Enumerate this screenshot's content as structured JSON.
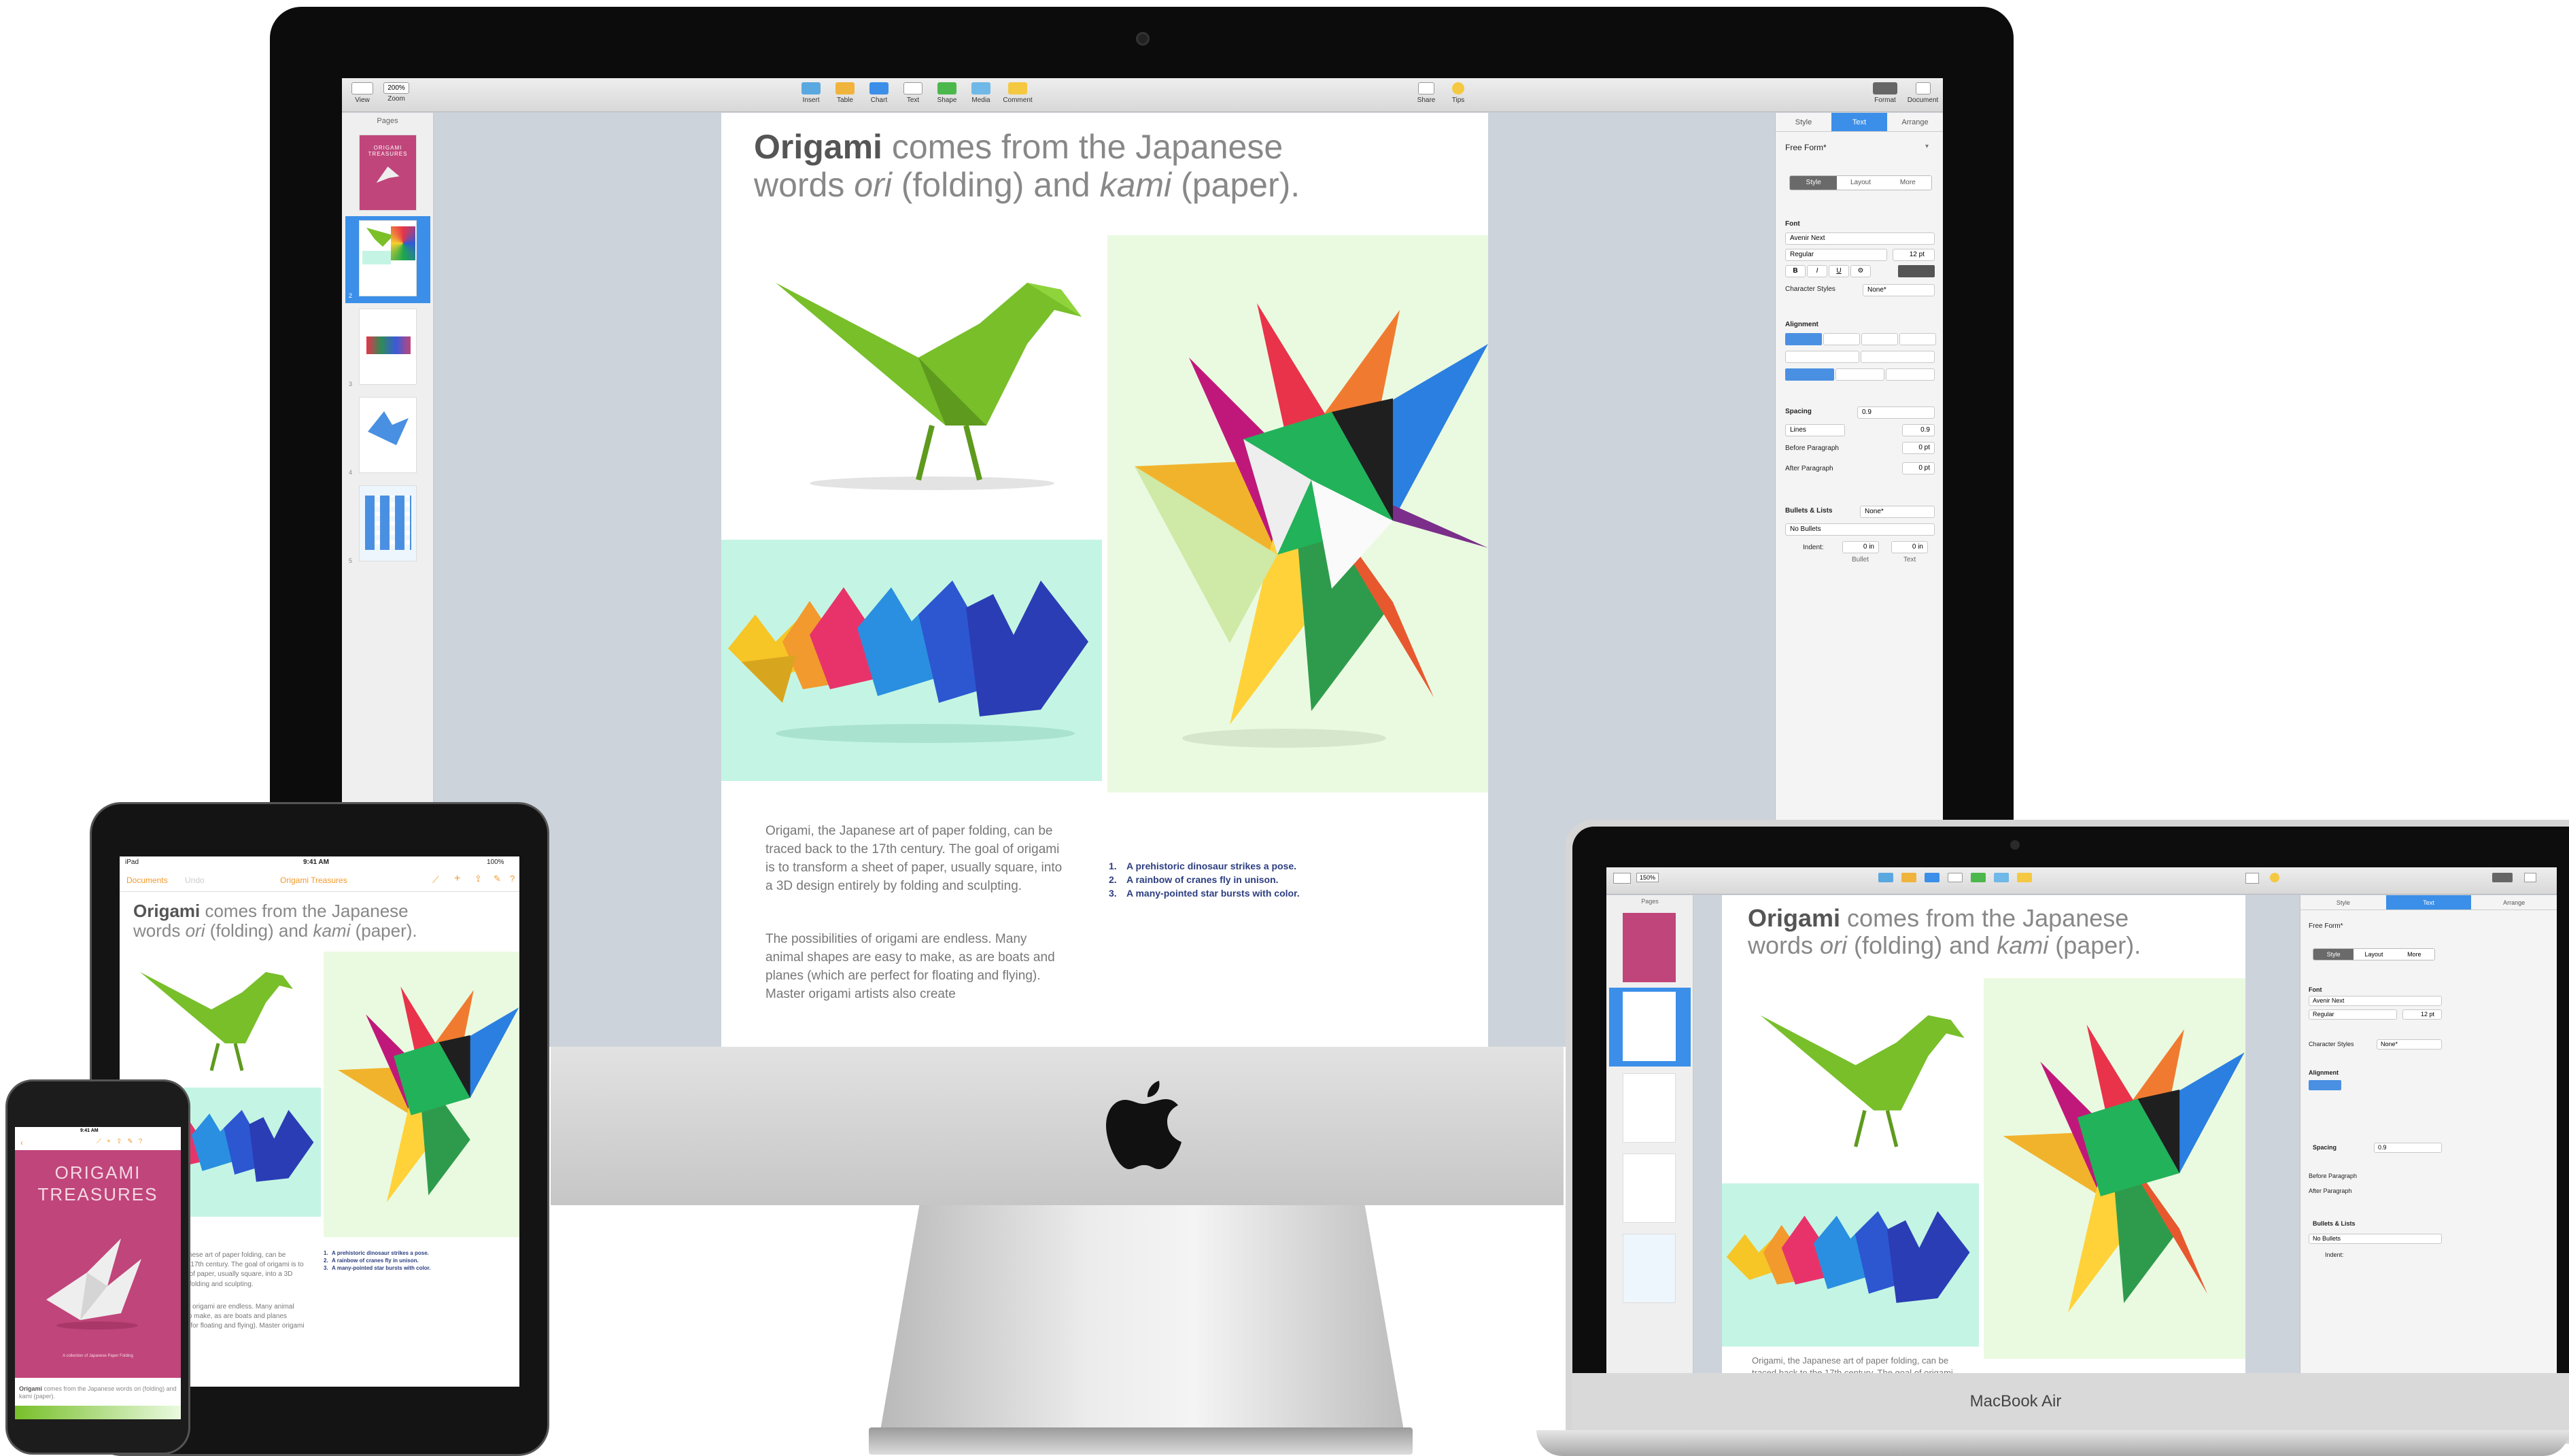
{
  "imac": {
    "toolbar": {
      "view": "View",
      "zoom_value": "200%",
      "zoom": "Zoom",
      "insert": "Insert",
      "table": "Table",
      "chart": "Chart",
      "text": "Text",
      "shape": "Shape",
      "media": "Media",
      "comment": "Comment",
      "share": "Share",
      "tips": "Tips",
      "format": "Format",
      "document": "Document"
    },
    "pages_label": "Pages",
    "page_numbers": [
      "1",
      "2",
      "3",
      "4",
      "5"
    ],
    "inspector": {
      "tabs": [
        "Style",
        "Text",
        "Arrange"
      ],
      "selected_tab": "Text",
      "paragraph_style": "Free Form*",
      "subtabs": [
        "Style",
        "Layout",
        "More"
      ],
      "font_label": "Font",
      "font_name": "Avenir Next",
      "font_weight": "Regular",
      "font_size": "12 pt",
      "format_buttons": [
        "B",
        "I",
        "U"
      ],
      "char_styles_label": "Character Styles",
      "char_styles_value": "None*",
      "alignment_label": "Alignment",
      "spacing_label": "Spacing",
      "spacing_value": "0.9",
      "lines_label": "Lines",
      "lines_value": "0.9",
      "before_paragraph_label": "Before Paragraph",
      "before_paragraph_value": "0 pt",
      "after_paragraph_label": "After Paragraph",
      "after_paragraph_value": "0 pt",
      "bullets_label": "Bullets & Lists",
      "bullets_value": "None*",
      "no_bullets": "No Bullets",
      "indent_label": "Indent:",
      "indent_bullet_value": "0 in",
      "indent_text_value": "0 in",
      "bullet_label": "Bullet",
      "text_label": "Text"
    }
  },
  "document": {
    "heading_bold": "Origami",
    "heading_rest_1": " comes from the Japanese",
    "heading_line2_a": "words ",
    "heading_ori": "ori",
    "heading_line2_b": " (folding) and ",
    "heading_kami": "kami",
    "heading_line2_c": " (paper).",
    "paragraph_1": "Origami, the Japanese art of paper folding, can be traced back to the 17th century. The goal of origami is to transform a sheet of paper, usually square, into a 3D design entirely by folding and sculpting.",
    "paragraph_2": "The possibilities of origami are endless. Many animal shapes are easy to make, as are boats and planes (which are perfect for floating and flying). Master origami artists also create",
    "captions": [
      "A prehistoric dinosaur strikes a pose.",
      "A rainbow of cranes fly in unison.",
      "A many-pointed star bursts with color."
    ],
    "caption_nums": [
      "1.",
      "2.",
      "3."
    ]
  },
  "ipad": {
    "status_left": "iPad",
    "status_time": "9:41 AM",
    "status_battery": "100%",
    "nav_documents": "Documents",
    "nav_undo": "Undo",
    "nav_title": "Origami Treasures"
  },
  "iphone": {
    "status_time": "9:41 AM",
    "cover_title_line1": "ORIGAMI",
    "cover_title_line2": "TREASURES",
    "cover_subtitle": "A collection of Japanese Paper Folding",
    "footer_bold": "Origami",
    "footer_rest": " comes from the Japanese words ori (folding) and kami (paper)."
  },
  "macbook": {
    "brand": "MacBook Air",
    "zoom_value": "150%"
  },
  "colors": {
    "selection_blue": "#3b8fe8",
    "accent_orange": "#f29a2e",
    "cover_pink": "#c0457a",
    "mint": "#c4f5e4"
  }
}
